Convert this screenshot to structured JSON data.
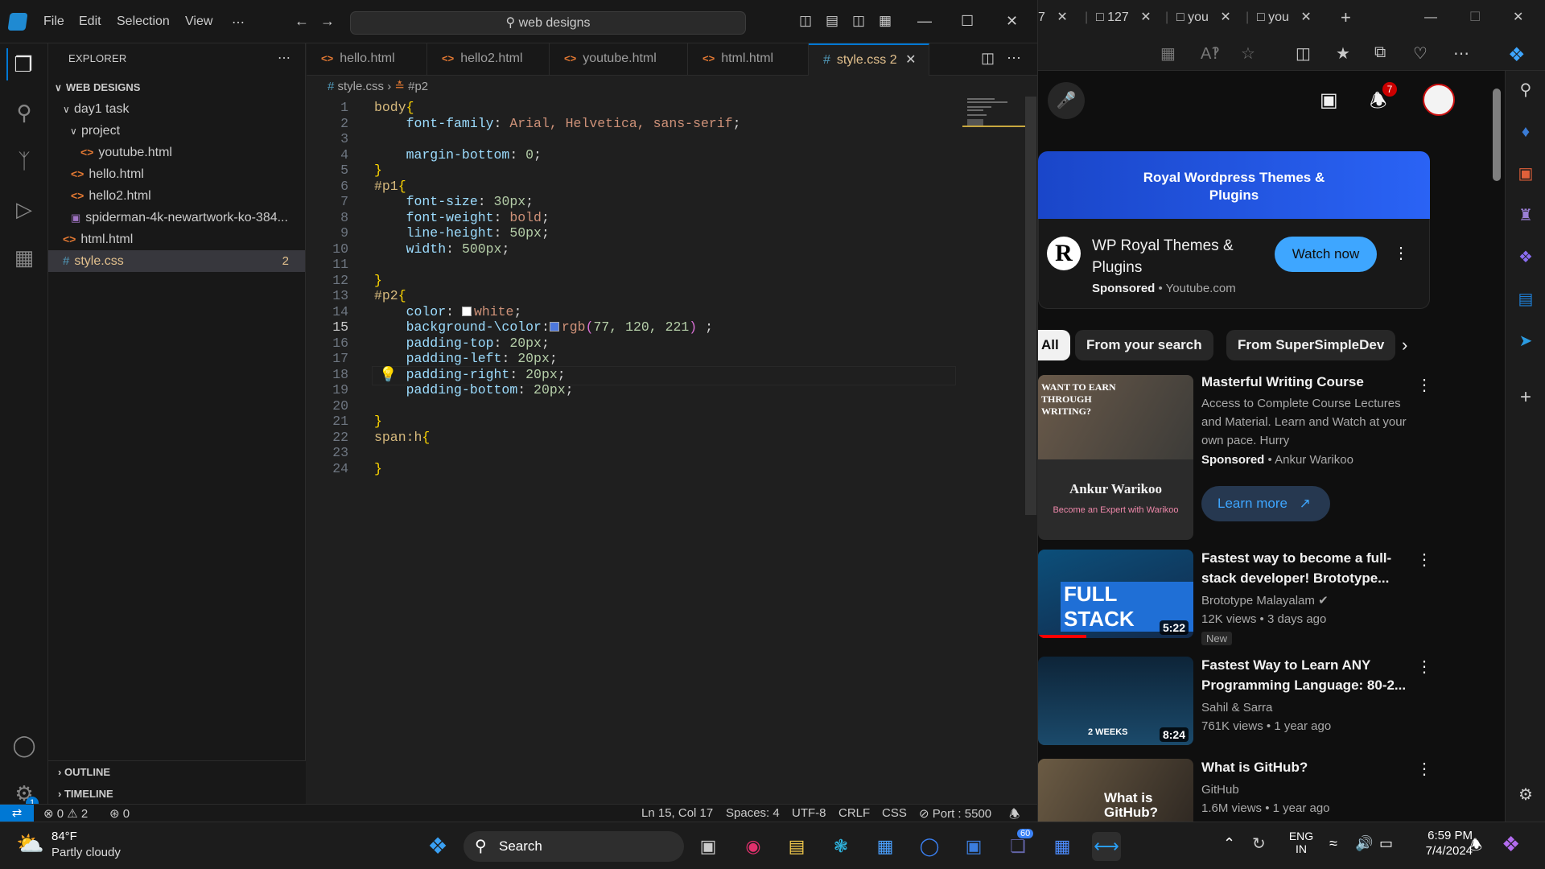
{
  "vscode": {
    "menu": [
      "File",
      "Edit",
      "Selection",
      "View",
      "⋯"
    ],
    "search": "web designs",
    "explorer": {
      "header": "EXPLORER",
      "root": "WEB DESIGNS",
      "items": [
        {
          "label": "day1 task",
          "depth": 1,
          "type": "folder"
        },
        {
          "label": "project",
          "depth": 2,
          "type": "folder"
        },
        {
          "label": "youtube.html",
          "depth": 3,
          "type": "html"
        },
        {
          "label": "hello.html",
          "depth": 2,
          "type": "html"
        },
        {
          "label": "hello2.html",
          "depth": 2,
          "type": "html"
        },
        {
          "label": "spiderman-4k-newartwork-ko-384...",
          "depth": 2,
          "type": "image"
        },
        {
          "label": "html.html",
          "depth": 1,
          "type": "html"
        },
        {
          "label": "style.css",
          "depth": 1,
          "type": "css",
          "badge": "2"
        }
      ],
      "outline": "OUTLINE",
      "timeline": "TIMELINE"
    },
    "tabs": [
      "hello.html",
      "hello2.html",
      "youtube.html",
      "html.html",
      "style.css"
    ],
    "active_tab_badge": "2",
    "breadcrumb": {
      "file": "style.css",
      "symbol": "#p2"
    },
    "code": [
      [
        {
          "t": "body",
          "c": "sel"
        },
        {
          "t": "{",
          "c": "brace"
        }
      ],
      [
        {
          "t": "    font-family",
          "c": "prop"
        },
        {
          "t": ": ",
          "c": "pun"
        },
        {
          "t": "Arial, Helvetica, sans-serif",
          "c": "val"
        },
        {
          "t": ";",
          "c": "pun"
        }
      ],
      [],
      [
        {
          "t": "    margin-bottom",
          "c": "prop"
        },
        {
          "t": ": ",
          "c": "pun"
        },
        {
          "t": "0",
          "c": "num"
        },
        {
          "t": ";",
          "c": "pun"
        }
      ],
      [
        {
          "t": "}",
          "c": "brace"
        }
      ],
      [
        {
          "t": "#p1",
          "c": "sel"
        },
        {
          "t": "{",
          "c": "brace"
        }
      ],
      [
        {
          "t": "    font-size",
          "c": "prop"
        },
        {
          "t": ": ",
          "c": "pun"
        },
        {
          "t": "30px",
          "c": "num"
        },
        {
          "t": ";",
          "c": "pun"
        }
      ],
      [
        {
          "t": "    font-weight",
          "c": "prop"
        },
        {
          "t": ": ",
          "c": "pun"
        },
        {
          "t": "bold",
          "c": "val"
        },
        {
          "t": ";",
          "c": "pun"
        }
      ],
      [
        {
          "t": "    line-height",
          "c": "prop"
        },
        {
          "t": ": ",
          "c": "pun"
        },
        {
          "t": "50px",
          "c": "num"
        },
        {
          "t": ";",
          "c": "pun"
        }
      ],
      [
        {
          "t": "    width",
          "c": "prop"
        },
        {
          "t": ": ",
          "c": "pun"
        },
        {
          "t": "500px",
          "c": "num"
        },
        {
          "t": ";",
          "c": "pun"
        }
      ],
      [],
      [
        {
          "t": "}",
          "c": "brace"
        }
      ],
      [
        {
          "t": "#p2",
          "c": "sel"
        },
        {
          "t": "{",
          "c": "brace"
        }
      ],
      [
        {
          "t": "    color",
          "c": "prop"
        },
        {
          "t": ": ",
          "c": "pun"
        },
        {
          "sw": "#ffffff"
        },
        {
          "t": "white",
          "c": "val"
        },
        {
          "t": ";",
          "c": "pun"
        }
      ],
      [
        {
          "t": "    background-\\color",
          "c": "prop"
        },
        {
          "t": ":",
          "c": "pun"
        },
        {
          "sw": "#4d78dd"
        },
        {
          "t": "rgb",
          "c": "val"
        },
        {
          "t": "(",
          "c": "brace2"
        },
        {
          "t": "77, 120, 221",
          "c": "num"
        },
        {
          "t": ")",
          "c": "brace2"
        },
        {
          "t": " ;",
          "c": "pun"
        }
      ],
      [
        {
          "t": "    padding-top",
          "c": "prop"
        },
        {
          "t": ": ",
          "c": "pun"
        },
        {
          "t": "20px",
          "c": "num"
        },
        {
          "t": ";",
          "c": "pun"
        }
      ],
      [
        {
          "t": "    padding-left",
          "c": "prop"
        },
        {
          "t": ": ",
          "c": "pun"
        },
        {
          "t": "20px",
          "c": "num"
        },
        {
          "t": ";",
          "c": "pun"
        }
      ],
      [
        {
          "t": "    padding-right",
          "c": "prop"
        },
        {
          "t": ": ",
          "c": "pun"
        },
        {
          "t": "20px",
          "c": "num"
        },
        {
          "t": ";",
          "c": "pun"
        }
      ],
      [
        {
          "t": "    padding-bottom",
          "c": "prop"
        },
        {
          "t": ": ",
          "c": "pun"
        },
        {
          "t": "20px",
          "c": "num"
        },
        {
          "t": ";",
          "c": "pun"
        }
      ],
      [],
      [
        {
          "t": "}",
          "c": "brace"
        }
      ],
      [
        {
          "t": "span:h",
          "c": "sel"
        },
        {
          "t": "{",
          "c": "brace"
        }
      ],
      [],
      [
        {
          "t": "}",
          "c": "brace"
        }
      ]
    ],
    "current_line": 15,
    "status": {
      "errors": "0",
      "warnings": "2",
      "ports": "0",
      "position": "Ln 15, Col 17",
      "spaces": "Spaces: 4",
      "encoding": "UTF-8",
      "eol": "CRLF",
      "language": "CSS",
      "port": "Port : 5500"
    },
    "settings_badge": "1"
  },
  "browser": {
    "tabs": [
      {
        "label": "7"
      },
      {
        "label": "127"
      },
      {
        "label": "you"
      },
      {
        "label": "you"
      }
    ],
    "notif_count": "7",
    "ad": {
      "banner": "Royal Wordpress Themes & Plugins",
      "title": "WP Royal Themes & Plugins",
      "sponsored": "Sponsored",
      "domain": "Youtube.com",
      "cta": "Watch now",
      "logo_letter": "R"
    },
    "chips": [
      "All",
      "From your search",
      "From SuperSimpleDev"
    ],
    "videos": [
      {
        "title": "Masterful Writing Course",
        "meta1": "Access to Complete Course Lectures and Material. Learn and Watch at your own pace. Hurry",
        "sponsored": "Sponsored",
        "channel": "Ankur Warikoo",
        "cta": "Learn more",
        "thumb_title": "WANT TO EARN THROUGH WRITING?",
        "thumb_name": "Ankur Warikoo",
        "thumb_sub": "Become an Expert with Warikoo"
      },
      {
        "title": "Fastest way to become a full-stack developer! Brototype...",
        "channel": "Brototype Malayalam",
        "views": "12K views",
        "age": "3 days ago",
        "badge": "New",
        "duration": "5:22",
        "thumb_text": "FULL STACK"
      },
      {
        "title": "Fastest Way to Learn ANY Programming Language: 80-2...",
        "channel": "Sahil & Sarra",
        "views": "761K views",
        "age": "1 year ago",
        "duration": "8:24",
        "thumb_text": "2 WEEKS"
      },
      {
        "title": "What is GitHub?",
        "channel": "GitHub",
        "views": "1.6M views",
        "age": "1 year ago",
        "thumb_text": "What is GitHub?"
      }
    ]
  },
  "taskbar": {
    "weather_temp": "84°F",
    "weather_desc": "Partly cloudy",
    "search": "Search",
    "lang1": "ENG",
    "lang2": "IN",
    "time": "6:59 PM",
    "date": "7/4/2024",
    "teams_badge": "60"
  },
  "colors": {
    "accent": "#0078d4",
    "yt_blue": "#3ea6ff",
    "css_yellow": "#e2c08d"
  }
}
